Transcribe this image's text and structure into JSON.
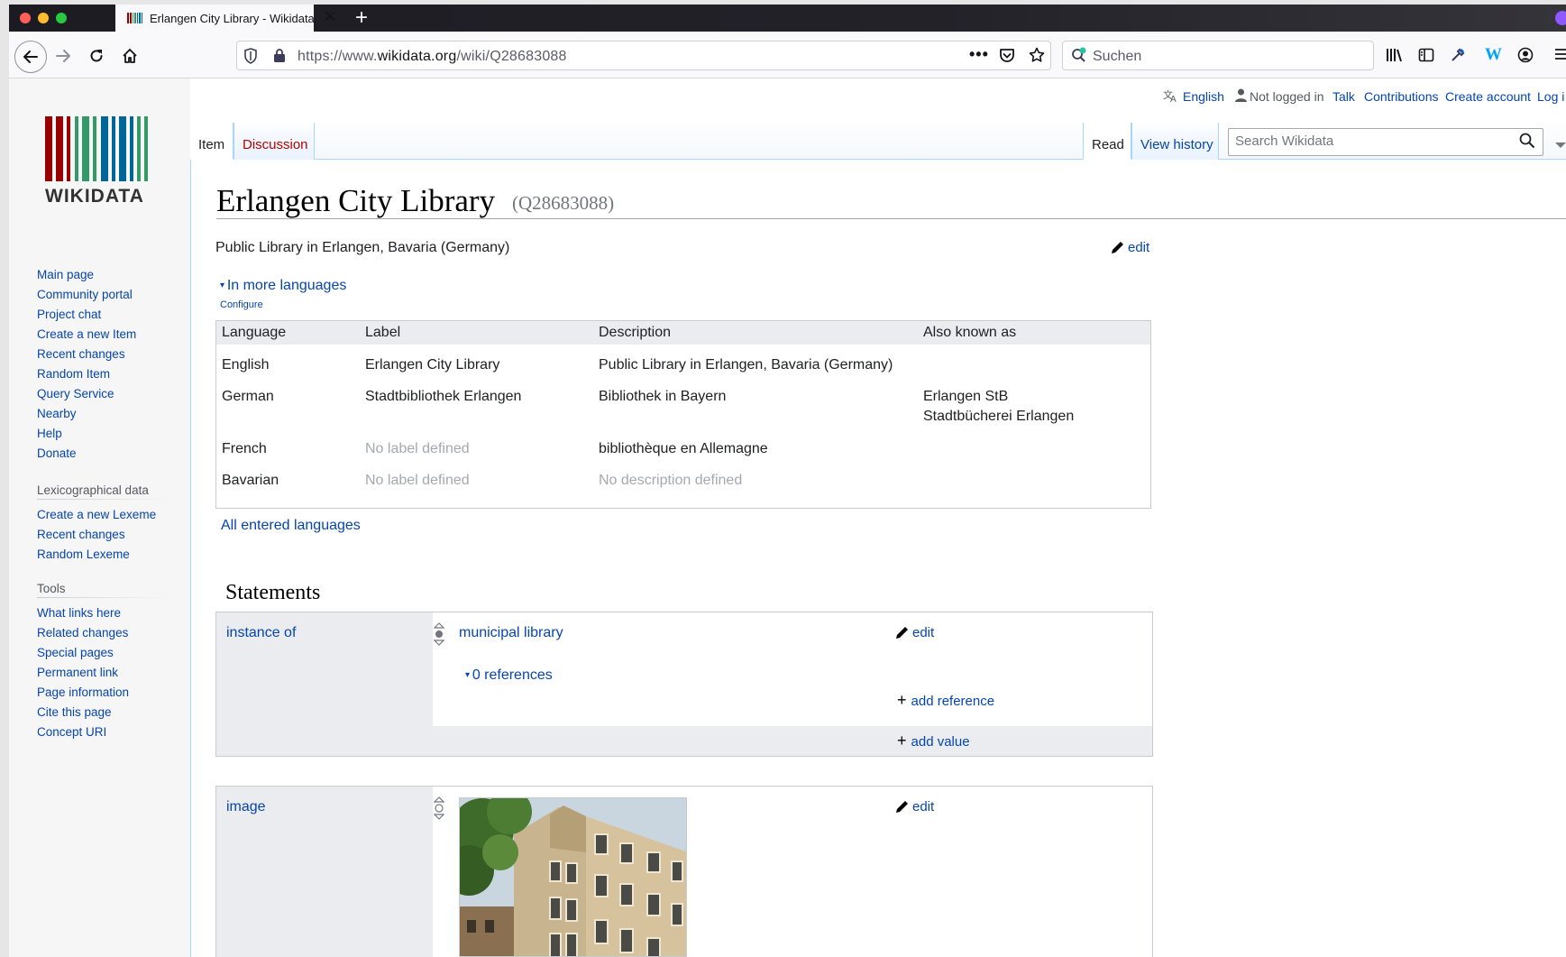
{
  "browser": {
    "tab_title": "Erlangen City Library - Wikidata",
    "url_prefix": "https://www.",
    "url_domain": "wikidata.org",
    "url_path": "/wiki/Q28683088",
    "search_placeholder": "Suchen",
    "traffic_light_colors": [
      "#ff5f57",
      "#febc2e",
      "#28c840"
    ]
  },
  "personal_bar": {
    "language": "English",
    "not_logged_in": "Not logged in",
    "talk": "Talk",
    "contributions": "Contributions",
    "create_account": "Create account",
    "log_in": "Log i"
  },
  "tabs": {
    "item": "Item",
    "discussion": "Discussion",
    "read": "Read",
    "view_history": "View history",
    "search_placeholder": "Search Wikidata"
  },
  "logo": {
    "wordmark": "WIKIDATA",
    "bar_colors": [
      "#990000",
      "#339966",
      "#006699"
    ]
  },
  "sidebar": {
    "navigation": [
      "Main page",
      "Community portal",
      "Project chat",
      "Create a new Item",
      "Recent changes",
      "Random Item",
      "Query Service",
      "Nearby",
      "Help",
      "Donate"
    ],
    "lexicographical": {
      "heading": "Lexicographical data",
      "items": [
        "Create a new Lexeme",
        "Recent changes",
        "Random Lexeme"
      ]
    },
    "tools": {
      "heading": "Tools",
      "items": [
        "What links here",
        "Related changes",
        "Special pages",
        "Permanent link",
        "Page information",
        "Cite this page",
        "Concept URI"
      ]
    }
  },
  "item": {
    "title": "Erlangen City Library",
    "qid": "(Q28683088)",
    "description": "Public Library in Erlangen, Bavaria (Germany)",
    "edit": "edit",
    "in_more_languages": "In more languages",
    "configure": "Configure",
    "all_languages": "All entered languages"
  },
  "lang_table": {
    "headers": [
      "Language",
      "Label",
      "Description",
      "Also known as"
    ],
    "rows": [
      {
        "language": "English",
        "label": "Erlangen City Library",
        "description": "Public Library in Erlangen, Bavaria (Germany)",
        "aliases": [
          "",
          ""
        ]
      },
      {
        "language": "German",
        "label": "Stadtbibliothek Erlangen",
        "description": "Bibliothek in Bayern",
        "aliases": [
          "Erlangen StB",
          "Stadtbücherei Erlangen"
        ]
      },
      {
        "language": "French",
        "label": "No label defined",
        "description": "bibliothèque en Allemagne",
        "aliases": [
          "",
          ""
        ]
      },
      {
        "language": "Bavarian",
        "label": "No label defined",
        "description": "No description defined",
        "aliases": [
          "",
          ""
        ]
      }
    ]
  },
  "statements": {
    "heading": "Statements",
    "instance_of": {
      "property": "instance of",
      "value": "municipal library",
      "edit": "edit",
      "references": "0 references",
      "add_reference": "add reference",
      "add_value": "add value"
    },
    "image": {
      "property": "image",
      "edit": "edit"
    }
  }
}
